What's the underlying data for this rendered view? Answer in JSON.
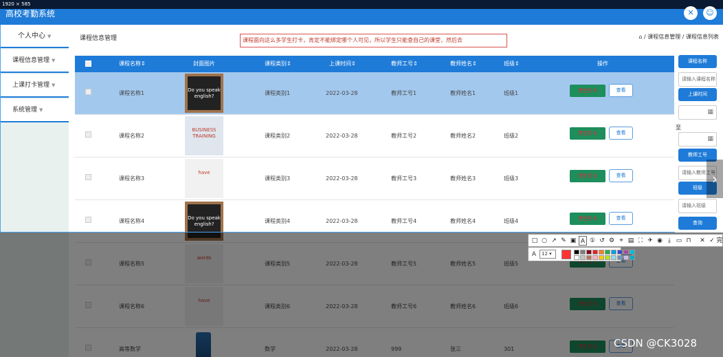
{
  "top_info": "1920 × 585",
  "header": {
    "title": "高校考勤系统"
  },
  "sidebar": {
    "items": [
      {
        "label": "个人中心"
      },
      {
        "label": "课程信息管理"
      },
      {
        "label": "上课打卡管理"
      },
      {
        "label": "系统管理"
      }
    ]
  },
  "breadcrumb": {
    "page": "课程信息管理",
    "path": "课程信息管理 / 课程信息列表"
  },
  "annotation": "课程面向这么多学生打卡，肯定不能绑定哪个人可见，所以学生只能查自己的课堂，然后去",
  "table": {
    "headers": [
      "课程名称",
      "封面图片",
      "课程类别",
      "上课时间",
      "教师工号",
      "教师姓名",
      "班级",
      "操作"
    ],
    "rows": [
      {
        "name": "课程名称1",
        "cat": "课程类别1",
        "time": "2022-03-28",
        "tid": "教师工号1",
        "tname": "教师姓名1",
        "cls": "班级1"
      },
      {
        "name": "课程名称2",
        "cat": "课程类别2",
        "time": "2022-03-28",
        "tid": "教师工号2",
        "tname": "教师姓名2",
        "cls": "班级2"
      },
      {
        "name": "课程名称3",
        "cat": "课程类别3",
        "time": "2022-03-28",
        "tid": "教师工号3",
        "tname": "教师姓名3",
        "cls": "班级3"
      },
      {
        "name": "课程名称4",
        "cat": "课程类别4",
        "time": "2022-03-28",
        "tid": "教师工号4",
        "tname": "教师姓名4",
        "cls": "班级4"
      },
      {
        "name": "课程名称5",
        "cat": "课程类别5",
        "time": "2022-03-28",
        "tid": "教师工号5",
        "tname": "教师姓名5",
        "cls": "班级5"
      },
      {
        "name": "课程名称6",
        "cat": "课程类别6",
        "time": "2022-03-28",
        "tid": "教师工号6",
        "tname": "教师姓名6",
        "cls": "班级6"
      },
      {
        "name": "高等数学",
        "cat": "数学",
        "time": "2022-03-28",
        "tid": "999",
        "tname": "张三",
        "cls": "301"
      }
    ],
    "attend_label": "学生打卡",
    "view_label": "查看",
    "thumbs": [
      "Do you speak english?",
      "BUSINESS TRAINING",
      "have",
      "Do you speak english?",
      "words",
      "have",
      ""
    ]
  },
  "search_panel": {
    "name_btn": "课程名称",
    "name_placeholder": "请输入课程名称",
    "time_btn": "上课时间",
    "to_label": "至",
    "tid_btn": "教师工号",
    "tid_placeholder": "请输入教师工号",
    "cls_btn": "班级",
    "cls_placeholder": "请输入班级",
    "query_btn": "查询"
  },
  "tool": {
    "font_size": "12",
    "done": "完成"
  },
  "colors": {
    "primary": "#1e7bd8",
    "attend_bg": "#1d8e5c",
    "attend_text": "#ee2233",
    "selected_row": "#a3c8ee",
    "annotation": "#d9534f"
  },
  "watermark": "CSDN @CK3028"
}
